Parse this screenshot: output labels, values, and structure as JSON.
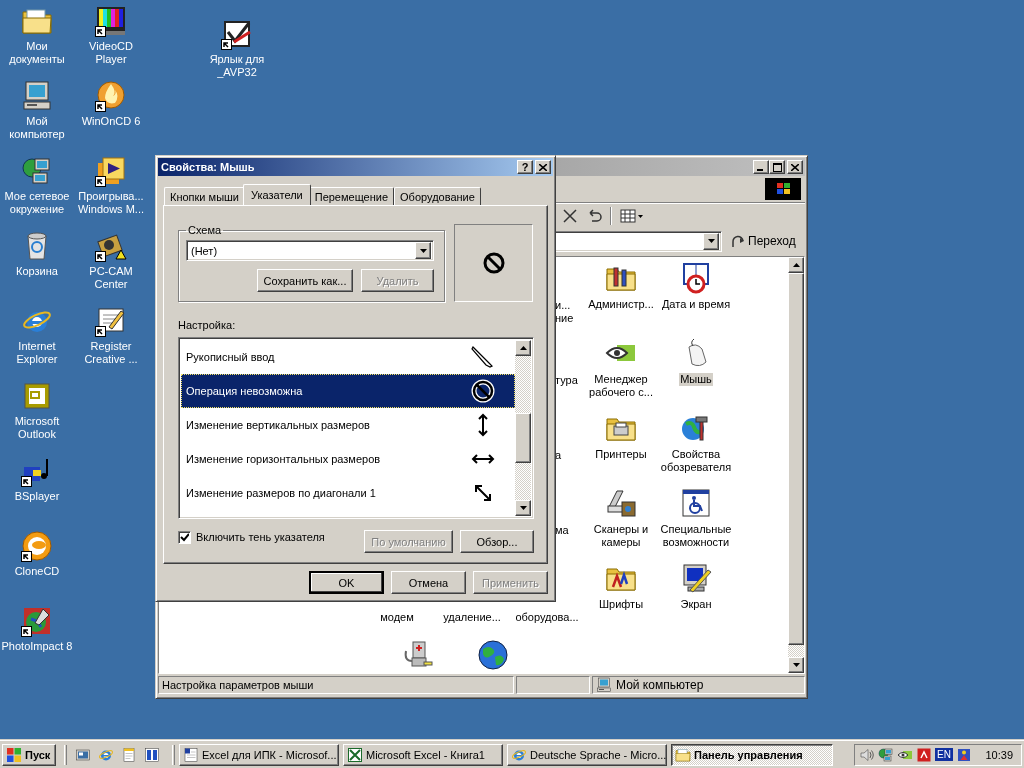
{
  "desktop_icons": [
    {
      "label": "Мои документы",
      "shortcut": false
    },
    {
      "label": "Мой компьютер",
      "shortcut": false
    },
    {
      "label": "Мое сетевое окружение",
      "shortcut": false
    },
    {
      "label": "Корзина",
      "shortcut": false
    },
    {
      "label": "Internet Explorer",
      "shortcut": false
    },
    {
      "label": "Microsoft Outlook",
      "shortcut": false
    },
    {
      "label": "BSplayer",
      "shortcut": true
    },
    {
      "label": "CloneCD",
      "shortcut": true
    },
    {
      "label": "PhotoImpact 8",
      "shortcut": true
    },
    {
      "label": "VideoCD Player",
      "shortcut": true
    },
    {
      "label": "WinOnCD 6",
      "shortcut": true
    },
    {
      "label": "Проигрыва... Windows M...",
      "shortcut": true
    },
    {
      "label": "PC-CAM Center",
      "shortcut": true
    },
    {
      "label": "Register Creative ...",
      "shortcut": true
    },
    {
      "label": "Ярлык для _AVP32",
      "shortcut": true
    }
  ],
  "control_panel": {
    "go_button": "Переход",
    "items": [
      {
        "label": "Администр...",
        "selected": false
      },
      {
        "label": "Дата и время",
        "selected": false
      },
      {
        "label": "Менеджер рабочего с...",
        "selected": false
      },
      {
        "label": "Мышь",
        "selected": true
      },
      {
        "label": "Принтеры",
        "selected": false
      },
      {
        "label": "Свойства обозревателя",
        "selected": false
      },
      {
        "label": "Сканеры и камеры",
        "selected": false
      },
      {
        "label": "Специальные возможности",
        "selected": false
      },
      {
        "label": "Шрифты",
        "selected": false
      },
      {
        "label": "Экран",
        "selected": false
      }
    ],
    "partial_labels": [
      "и...",
      "ние",
      "тура",
      "а",
      "ма",
      "модем",
      "удаление...",
      "оборудова..."
    ],
    "status_bar": {
      "hint": "Настройка параметров мыши",
      "zone": "Мой компьютер"
    }
  },
  "mouse_dialog": {
    "title": "Свойства: Мышь",
    "help_button": "?",
    "tabs": [
      {
        "label": "Кнопки мыши",
        "selected": false
      },
      {
        "label": "Указатели",
        "selected": true
      },
      {
        "label": "Перемещение",
        "selected": false
      },
      {
        "label": "Оборудование",
        "selected": false
      }
    ],
    "scheme": {
      "label": "Схема",
      "value": "(Нет)",
      "buttons": [
        {
          "label": "Сохранить как...",
          "disabled": false
        },
        {
          "label": "Удалить",
          "disabled": true
        }
      ]
    },
    "customize_label": "Настройка:",
    "pointers": [
      {
        "label": "Рукописный ввод",
        "selected": false
      },
      {
        "label": "Операция невозможна",
        "selected": true
      },
      {
        "label": "Изменение вертикальных размеров",
        "selected": false
      },
      {
        "label": "Изменение горизонтальных размеров",
        "selected": false
      },
      {
        "label": "Изменение размеров по диагонали 1",
        "selected": false
      }
    ],
    "shadow": {
      "label": "Включить тень указателя",
      "checked": true
    },
    "pointer_buttons": [
      {
        "label": "По умолчанию",
        "disabled": true
      },
      {
        "label": "Обзор...",
        "disabled": false
      }
    ],
    "buttons": [
      {
        "label": "OK",
        "disabled": false,
        "default": true
      },
      {
        "label": "Отмена",
        "disabled": false,
        "default": false
      },
      {
        "label": "Применить",
        "disabled": true,
        "default": false
      }
    ]
  },
  "taskbar": {
    "start": "Пуск",
    "tasks": [
      {
        "label": "Excel для ИПК - Microsof...",
        "active": false
      },
      {
        "label": "Microsoft Excel - Книга1",
        "active": false
      },
      {
        "label": "Deutsche Sprache - Micro...",
        "active": false
      },
      {
        "label": "Панель управления",
        "active": true
      }
    ],
    "language": "EN",
    "time": "10:39"
  }
}
